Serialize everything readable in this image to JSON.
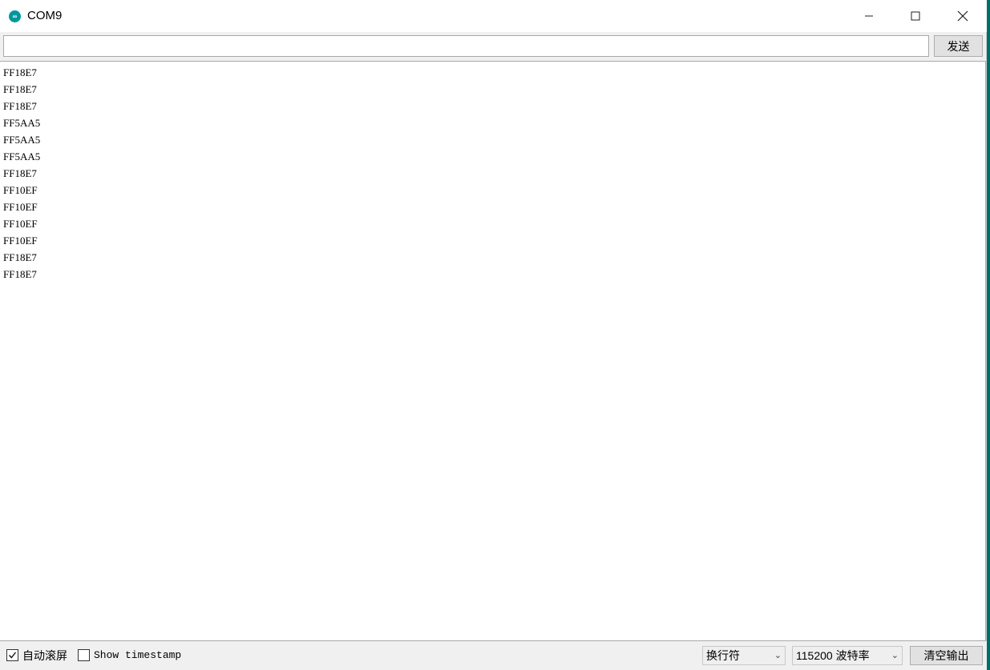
{
  "window": {
    "title": "COM9",
    "icon_text": "∞",
    "accent_color": "#00979c"
  },
  "send": {
    "input_value": "",
    "button_label": "发送"
  },
  "output": {
    "lines": [
      "FF18E7",
      "FF18E7",
      "FF18E7",
      "FF5AA5",
      "FF5AA5",
      "FF5AA5",
      "FF18E7",
      "FF10EF",
      "FF10EF",
      "FF10EF",
      "FF10EF",
      "FF18E7",
      "FF18E7"
    ]
  },
  "status": {
    "autoscroll_label": "自动滚屏",
    "autoscroll_checked": true,
    "timestamp_label": "Show timestamp",
    "timestamp_checked": false,
    "line_ending_selected": "换行符",
    "baud_selected": "115200 波特率",
    "clear_button_label": "清空输出"
  }
}
